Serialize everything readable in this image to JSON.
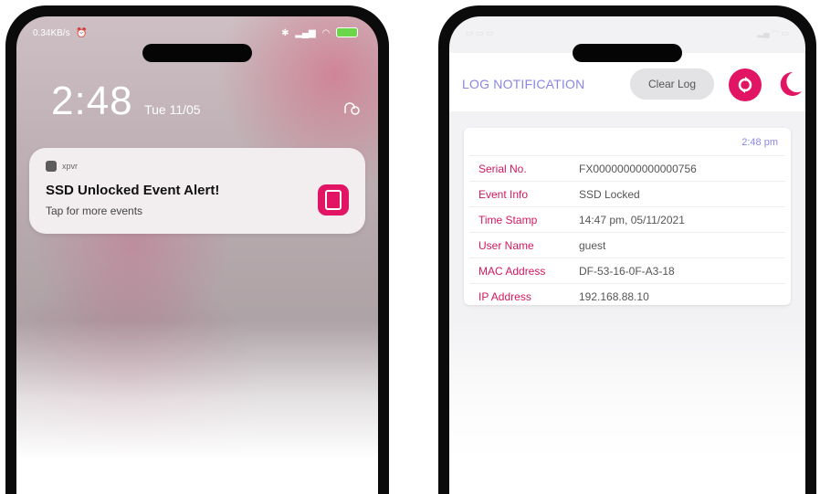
{
  "lock_screen": {
    "status_bar": {
      "left_text": "0.34KB/s",
      "alarm_icon": "alarm-icon",
      "battery_icon": "battery-icon"
    },
    "time": "2:48",
    "date": "Tue 11/05",
    "notification": {
      "app_name": "xpvr",
      "title": "SSD Unlocked Event Alert!",
      "subtitle": "Tap for more events",
      "icon": "ssd-app-icon",
      "badge_color": "#e21565"
    }
  },
  "app_screen": {
    "header": {
      "title": "LOG NOTIFICATION",
      "clear_button_label": "Clear Log",
      "sync_icon": "sync-icon",
      "theme_icon": "moon-icon",
      "accent_color": "#e21565",
      "title_color": "#8a86e6"
    },
    "log_entry": {
      "time": "2:48 pm",
      "rows": [
        {
          "label": "Serial No.",
          "value": "FX00000000000000756"
        },
        {
          "label": "Event Info",
          "value": "SSD Locked"
        },
        {
          "label": "Time Stamp",
          "value": "14:47 pm, 05/11/2021"
        },
        {
          "label": "User Name",
          "value": "guest"
        },
        {
          "label": "MAC Address",
          "value": "DF-53-16-0F-A3-18"
        },
        {
          "label": "IP Address",
          "value": "192.168.88.10"
        }
      ]
    }
  }
}
